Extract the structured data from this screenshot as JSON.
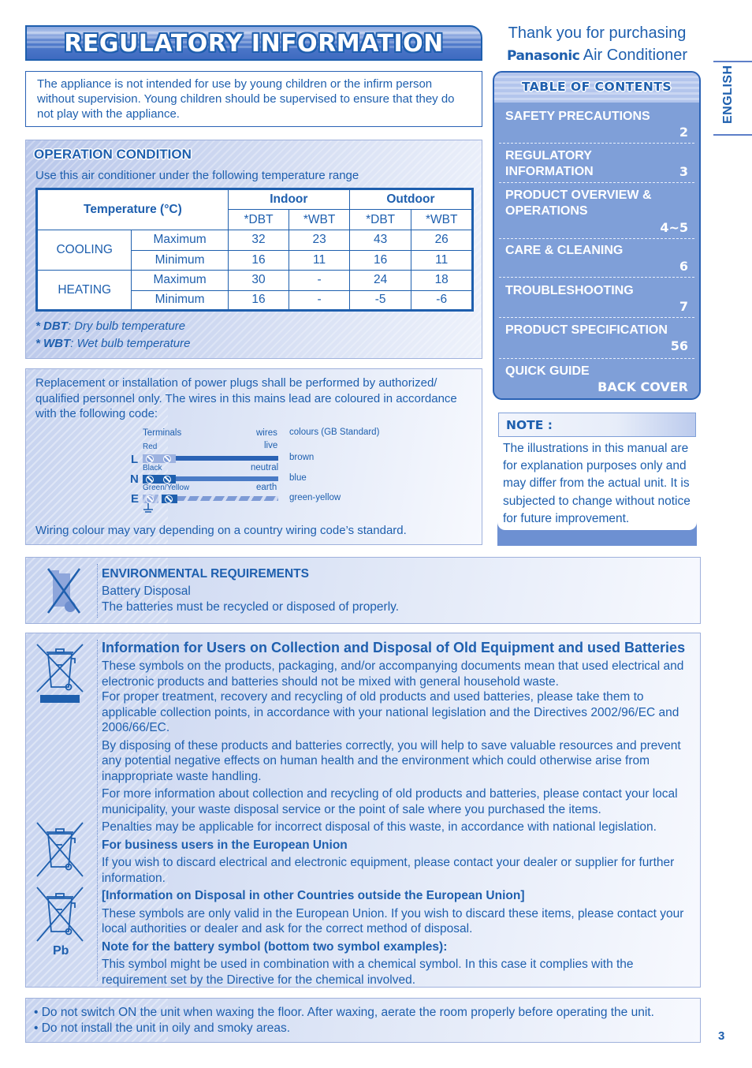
{
  "page": {
    "title": "REGULATORY INFORMATION",
    "page_number": "3",
    "language_tab": "ENGLISH"
  },
  "intro": {
    "text": "The appliance is not intended for use by young children or the infirm person without supervision. Young children should be supervised to ensure that they do not play with the appliance."
  },
  "header_right": {
    "thanks_line": "Thank you for purchasing",
    "brand": "Panasonic",
    "product": "Air Conditioner"
  },
  "toc": {
    "title": "TABLE OF CONTENTS",
    "items": [
      {
        "label": "SAFETY PRECAUTIONS",
        "page": "2"
      },
      {
        "label": "REGULATORY INFORMATION",
        "page": "3"
      },
      {
        "label": "PRODUCT OVERVIEW & OPERATIONS",
        "page": "4~5"
      },
      {
        "label": "CARE & CLEANING",
        "page": "6"
      },
      {
        "label": "TROUBLESHOOTING",
        "page": "7"
      },
      {
        "label": "PRODUCT SPECIFICATION",
        "page": "56"
      },
      {
        "label": "QUICK GUIDE",
        "page": "BACK COVER"
      }
    ]
  },
  "note": {
    "title": "NOTE :",
    "text": "The illustrations in this manual are for explanation purposes only and may differ from the actual unit. It is subjected to change without notice for future improvement."
  },
  "operation_condition": {
    "title": "OPERATION CONDITION",
    "subtitle": "Use this air conditioner under the following temperature range",
    "table": {
      "header_temperature": "Temperature (°C)",
      "header_indoor": "Indoor",
      "header_outdoor": "Outdoor",
      "subheaders": [
        "*DBT",
        "*WBT",
        "*DBT",
        "*WBT"
      ],
      "rows": [
        {
          "mode": "COOLING",
          "limit": "Maximum",
          "values": [
            "32",
            "23",
            "43",
            "26"
          ]
        },
        {
          "mode": "COOLING",
          "limit": "Minimum",
          "values": [
            "16",
            "11",
            "16",
            "11"
          ]
        },
        {
          "mode": "HEATING",
          "limit": "Maximum",
          "values": [
            "30",
            "-",
            "24",
            "18"
          ]
        },
        {
          "mode": "HEATING",
          "limit": "Minimum",
          "values": [
            "16",
            "-",
            "-5",
            "-6"
          ]
        }
      ]
    },
    "footnotes": [
      {
        "abbr": "* DBT",
        "text": ":  Dry bulb temperature"
      },
      {
        "abbr": "* WBT",
        "text": ":  Wet bulb temperature"
      }
    ]
  },
  "wiring": {
    "intro": "Replacement or installation of power plugs shall be performed by authorized/ qualified personnel only. The wires in this mains lead are coloured in accordance with the following code:",
    "col_terminals": "Terminals",
    "col_wires": "wires",
    "col_colours": "colours (GB Standard)",
    "lines": [
      {
        "letter": "L",
        "terminal": "Red",
        "wire": "live",
        "colour": "brown"
      },
      {
        "letter": "N",
        "terminal": "Black",
        "wire": "neutral",
        "colour": "blue"
      },
      {
        "letter": "E",
        "terminal": "Green/Yellow",
        "wire": "earth",
        "colour": "green-yellow"
      }
    ],
    "note": "Wiring colour may vary depending on a country wiring code’s standard."
  },
  "environmental": {
    "title": "ENVIRONMENTAL REQUIREMENTS",
    "line1": "Battery Disposal",
    "line2": "The batteries must be recycled or disposed of properly."
  },
  "disposal": {
    "title": "Information for Users on Collection and Disposal of Old Equipment and used Batteries",
    "p1": "These symbols on the products, packaging, and/or accompanying documents mean that used electrical and electronic products and batteries should not be mixed with general household waste.",
    "p2": "For proper treatment, recovery and recycling of old products and used batteries, please take them to applicable collection points, in accordance with your national legislation and the Directives 2002/96/EC and 2006/66/EC.",
    "p3": "By disposing of these products and batteries correctly, you will help to save valuable resources and prevent any potential negative effects on human health and the environment which could otherwise arise from inappropriate waste handling.",
    "p4": "For more information about collection and recycling of old products and batteries, please contact your local municipality, your waste disposal service or the point of sale where you purchased the items.",
    "p5": "Penalties may be applicable for incorrect disposal of this waste, in accordance with national legislation.",
    "h_business": "For business users in the European Union",
    "p_business": "If you wish to discard electrical and electronic equipment, please contact your dealer or supplier for further information.",
    "h_outside": "[Information on Disposal in other Countries outside the European Union]",
    "p_outside": "These symbols are only valid in the European Union. If you wish to discard these items, please contact your local authorities or dealer and ask for the correct method of disposal.",
    "h_battery": "Note for the battery symbol (bottom two symbol examples):",
    "p_battery": "This symbol might be used in combination with a chemical symbol. In this case it complies with the requirement set by the Directive for the chemical involved.",
    "chemical_symbol": "Pb"
  },
  "warnings": {
    "items": [
      "• Do not switch ON the unit when waxing the floor. After waxing, aerate the room properly before operating the unit.",
      "• Do not install the unit in oily and smoky areas."
    ]
  },
  "colors": {
    "primary_blue": "#1e5fae",
    "toc_fill": "#7f9fd8",
    "panel_light": "#cfd9f1"
  }
}
